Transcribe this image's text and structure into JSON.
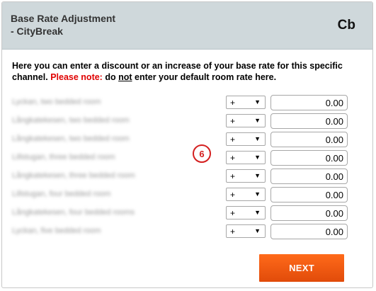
{
  "header": {
    "title": "Base Rate Adjustment\n- CityBreak",
    "code": "Cb"
  },
  "intro": {
    "text": "Here you can enter a discount or an increase of your base rate for this specific channel.",
    "note_label": "Please note:",
    "text2": "do",
    "not": "not",
    "text3": "enter your default room rate here."
  },
  "rooms": [
    {
      "label": "Lyckan, two bedded room",
      "sign": "+",
      "amount": "0.00"
    },
    {
      "label": "Långkatekesen, two bedded room",
      "sign": "+",
      "amount": "0.00"
    },
    {
      "label": "Långkatekesen, two bedded room",
      "sign": "+",
      "amount": "0.00"
    },
    {
      "label": "Lillstugan, three bedded room",
      "sign": "+",
      "amount": "0.00"
    },
    {
      "label": "Långkatekesen, three bedded room",
      "sign": "+",
      "amount": "0.00"
    },
    {
      "label": "Lillstugan, four bedded room",
      "sign": "+",
      "amount": "0.00"
    },
    {
      "label": "Långkatekesen, four bedded rooms",
      "sign": "+",
      "amount": "0.00"
    },
    {
      "label": "Lyckan, five bedded room",
      "sign": "+",
      "amount": "0.00"
    }
  ],
  "step_marker": "6",
  "actions": {
    "next_label": "NEXT"
  },
  "colors": {
    "header_bg": "#cfd8db",
    "note": "#e00000",
    "accent": "#f0580f",
    "marker": "#d41f1f"
  }
}
